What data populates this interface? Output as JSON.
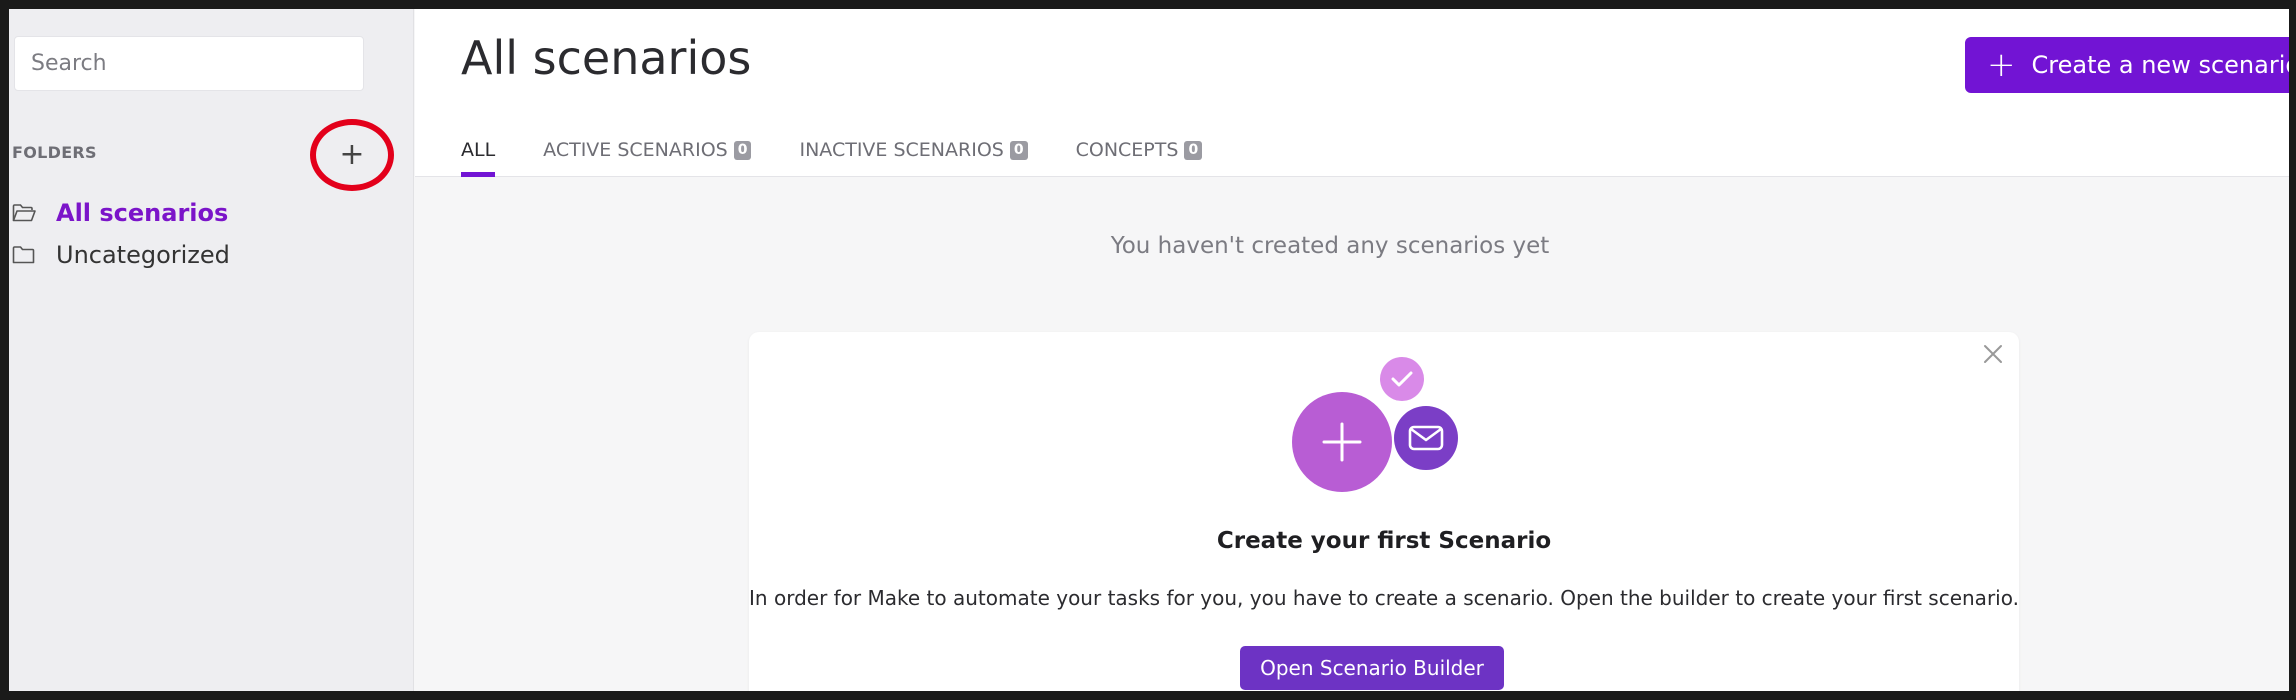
{
  "sidebar": {
    "search_placeholder": "Search",
    "folders_label": "FOLDERS",
    "add_folder_icon": "plus-icon",
    "items": [
      {
        "label": "All scenarios",
        "icon": "folder-open-icon",
        "active": true
      },
      {
        "label": "Uncategorized",
        "icon": "folder-icon",
        "active": false
      }
    ]
  },
  "header": {
    "title": "All scenarios",
    "create_button_label": "Create a new scenario",
    "tabs": [
      {
        "label": "ALL",
        "count": null,
        "active": true
      },
      {
        "label": "ACTIVE SCENARIOS",
        "count": "0"
      },
      {
        "label": "INACTIVE SCENARIOS",
        "count": "0"
      },
      {
        "label": "CONCEPTS",
        "count": "0"
      }
    ]
  },
  "main": {
    "empty_message": "You haven't created any scenarios yet",
    "card": {
      "title": "Create your first Scenario",
      "description": "In order for Make to automate your tasks for you, you have to create a scenario. Open the builder to create your first scenario.",
      "button_label": "Open Scenario Builder"
    }
  },
  "colors": {
    "accent": "#7214d4",
    "highlight_circle": "#e3001b",
    "illustration_plus": "#b85dd4",
    "illustration_mail": "#7b3ec6",
    "illustration_check": "#d98ae8"
  }
}
